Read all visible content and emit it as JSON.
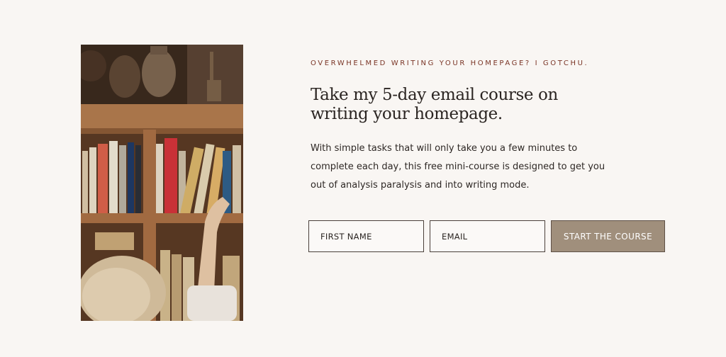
{
  "hero": {
    "image_alt": "Child reaching for a book on a wooden bookshelf",
    "eyebrow": "OVERWHELMED WRITING YOUR HOMEPAGE? I GOTCHU.",
    "headline": "Take my 5-day email course on writing your homepage.",
    "body": "With simple tasks that will only take you a few minutes to complete each day, this free mini-course is designed to get you out of analysis paralysis and into writing mode."
  },
  "form": {
    "first_name_placeholder": "FIRST NAME",
    "email_placeholder": "EMAIL",
    "submit_label": "START THE COURSE"
  },
  "colors": {
    "background": "#f9f6f3",
    "eyebrow": "#7a3526",
    "button": "#a08f7c",
    "text": "#2b2522"
  }
}
